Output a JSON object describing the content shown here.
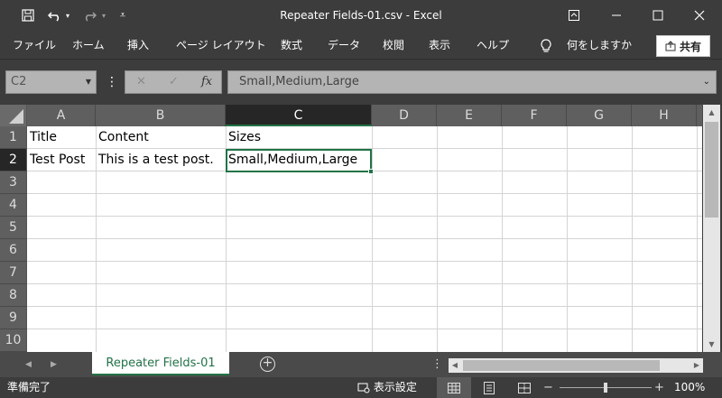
{
  "window": {
    "title": "Repeater Fields-01.csv  -  Excel",
    "qat": {
      "save_icon": "save-icon",
      "undo_icon": "undo-icon",
      "redo_icon": "redo-icon",
      "customize_icon": "customize-qat-icon"
    },
    "controls": {
      "ribbon_display_icon": "ribbon-display-icon",
      "minimize_icon": "minimize-icon",
      "maximize_icon": "maximize-icon",
      "close_icon": "close-icon"
    }
  },
  "menu": {
    "items": [
      "ファイル",
      "ホーム",
      "挿入",
      "ページ レイアウト",
      "数式",
      "データ",
      "校閲",
      "表示",
      "ヘルプ"
    ],
    "tell_me": "何をしますか",
    "share": "共有"
  },
  "formula_bar": {
    "name_box": "C2",
    "cancel": "✕",
    "enter": "✓",
    "function": "fx",
    "content": "Small,Medium,Large"
  },
  "grid": {
    "columns": [
      "A",
      "B",
      "C",
      "D",
      "E",
      "F",
      "G",
      "H"
    ],
    "selected_column": "C",
    "rows": [
      "1",
      "2",
      "3",
      "4",
      "5",
      "6",
      "7",
      "8",
      "9",
      "10"
    ],
    "selected_row": "2",
    "cells": {
      "A1": "Title",
      "B1": "Content",
      "C1": "Sizes",
      "A2": "Test Post",
      "B2": "This is a test post.",
      "C2": "Small,Medium,Large"
    },
    "active_cell": "C2"
  },
  "sheets": {
    "tabs": [
      "Repeater Fields-01"
    ],
    "active": "Repeater Fields-01"
  },
  "status": {
    "ready": "準備完了",
    "display_settings": "表示設定",
    "zoom": "100%",
    "zoom_minus": "−",
    "zoom_plus": "+"
  },
  "colors": {
    "accent": "#217346",
    "chrome": "#3c3c3c",
    "header": "#5f5f5f"
  }
}
